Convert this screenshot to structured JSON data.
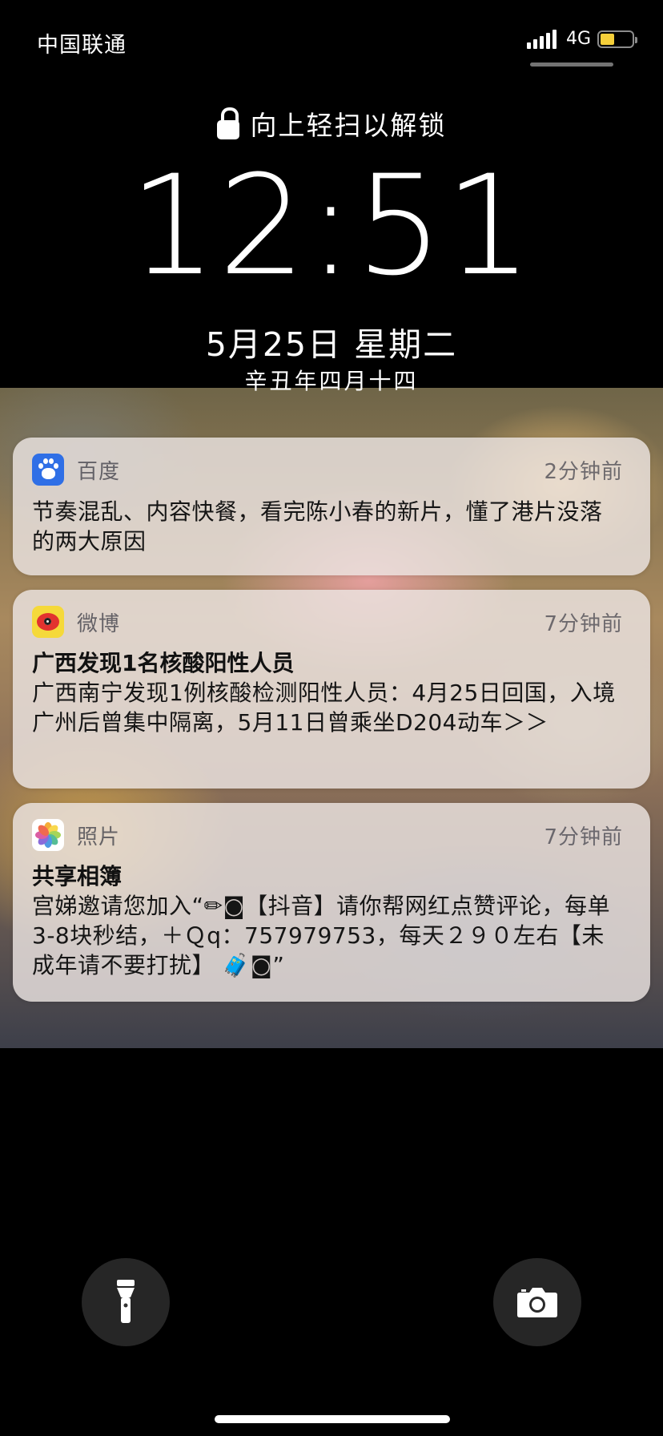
{
  "status_bar": {
    "carrier": "中国联通",
    "network": "4G",
    "battery_level": 0.45,
    "battery_color": "#f5cf3a"
  },
  "lock_screen": {
    "unlock_hint": "向上轻扫以解锁",
    "time": "12:51",
    "date": "5月25日 星期二",
    "lunar_date": "辛丑年四月十四"
  },
  "notifications": [
    {
      "app": "百度",
      "icon": "baidu-paw-icon",
      "time": "2分钟前",
      "title": "",
      "body": "节奏混乱、内容快餐，看完陈小春的新片，懂了港片没落的两大原因"
    },
    {
      "app": "微博",
      "icon": "weibo-icon",
      "time": "7分钟前",
      "title": "广西发现1名核酸阳性人员",
      "body": "广西南宁发现1例核酸检测阳性人员：4月25日回国，入境广州后曾集中隔离，5月11日曾乘坐D204动车＞＞"
    },
    {
      "app": "照片",
      "icon": "photos-flower-icon",
      "time": "7分钟前",
      "title": "共享相簿",
      "body": "宫娣邀请您加入“✏◙【抖音】请你帮网红点赞评论，每单3-8块秒结，＋Ｑq：757979753，每天２９０左右【未成年请不要打扰】 🧳◙”"
    }
  ],
  "buttons": {
    "flashlight": "flashlight-icon",
    "camera": "camera-icon"
  }
}
